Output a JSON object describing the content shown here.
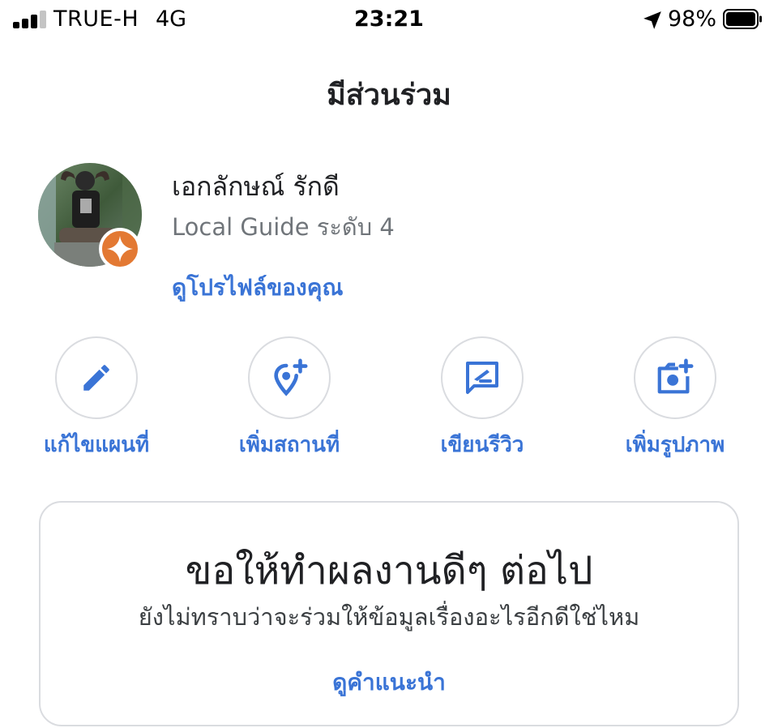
{
  "status_bar": {
    "carrier": "TRUE-H",
    "network": "4G",
    "time": "23:21",
    "battery_percent": "98%",
    "signal_bars": 4,
    "signal_bars_filled": 3,
    "battery_level": 0.98
  },
  "header": {
    "title": "มีส่วนร่วม"
  },
  "profile": {
    "name": "เอกลักษณ์ รักดี",
    "level": "Local Guide ระดับ 4",
    "view_profile_label": "ดูโปรไฟล์ของคุณ",
    "badge_color": "#e37933"
  },
  "actions": [
    {
      "label": "แก้ไขแผนที่",
      "icon": "pencil-icon"
    },
    {
      "label": "เพิ่มสถานที่",
      "icon": "add-place-icon"
    },
    {
      "label": "เขียนรีวิว",
      "icon": "write-review-icon"
    },
    {
      "label": "เพิ่มรูปภาพ",
      "icon": "add-photo-icon"
    }
  ],
  "card": {
    "title": "ขอให้ทำผลงานดีๆ ต่อไป",
    "subtitle": "ยังไม่ทราบว่าจะร่วมให้ข้อมูลเรื่องอะไรอีกดีใช่ไหม",
    "link_label": "ดูคำแนะนำ"
  },
  "colors": {
    "accent": "#3a74d6",
    "text": "#202124",
    "secondary_text": "#70757a",
    "border": "#dadce0"
  }
}
